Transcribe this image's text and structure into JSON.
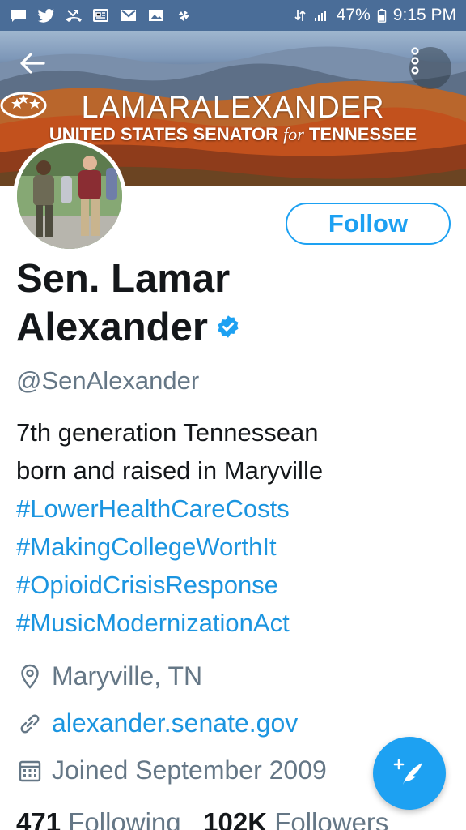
{
  "status_bar": {
    "battery": "47%",
    "time": "9:15 PM",
    "left_icons": [
      "chat-icon",
      "twitter-icon",
      "missed-call-icon",
      "news-icon",
      "gmail-icon",
      "gallery-icon",
      "pinwheel-icon"
    ],
    "right_icons": [
      "data-arrows-icon",
      "signal-icon",
      "battery-icon"
    ]
  },
  "header": {
    "back_icon": "back-arrow-icon",
    "more_icon": "more-vertical-icon",
    "banner": {
      "title_left": "LAMAR",
      "title_right": "ALEXANDER",
      "subtitle_pre": "UNITED STATES SENATOR ",
      "subtitle_for": "for",
      "subtitle_post": " TENNESSEE"
    }
  },
  "profile": {
    "follow_label": "Follow",
    "name_line1": "Sen. Lamar",
    "name_line2": "Alexander",
    "handle": "@SenAlexander",
    "bio_line1": "7th generation Tennessean",
    "bio_line2": "born and raised in Maryville",
    "hashtags": [
      "#LowerHealthCareCosts",
      "#MakingCollegeWorthIt",
      "#OpioidCrisisResponse",
      "#MusicModernizationAct"
    ],
    "location": "Maryville, TN",
    "website": "alexander.senate.gov",
    "joined": "Joined September 2009",
    "following_count": "471",
    "following_label": "Following",
    "followers_count": "102K",
    "followers_label": "Followers"
  },
  "colors": {
    "accent": "#1da1f2",
    "link": "#1b95e0",
    "status_bar": "#4a6d98",
    "secondary_text": "#657786"
  },
  "fab_icon": "compose-tweet-icon"
}
